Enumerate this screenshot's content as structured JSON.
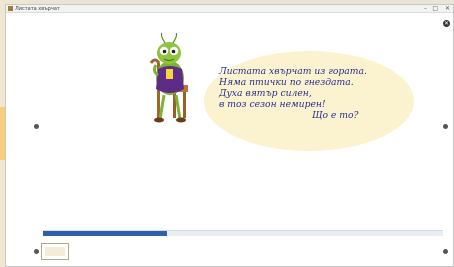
{
  "window": {
    "title": "Листата хвърчат",
    "controls": [
      "–",
      "□",
      "✕"
    ]
  },
  "poem": {
    "lines": [
      "Листата хвърчат из гората.",
      "Няма птички по гнездата.",
      "Духа вятър силен,",
      "в тоз сезон немирен!",
      "Що е то?"
    ]
  },
  "player": {
    "progress_fraction": 0.31
  },
  "icons": {
    "close": "close-icon",
    "prev": "previous-slide-icon",
    "next": "next-slide-icon"
  }
}
